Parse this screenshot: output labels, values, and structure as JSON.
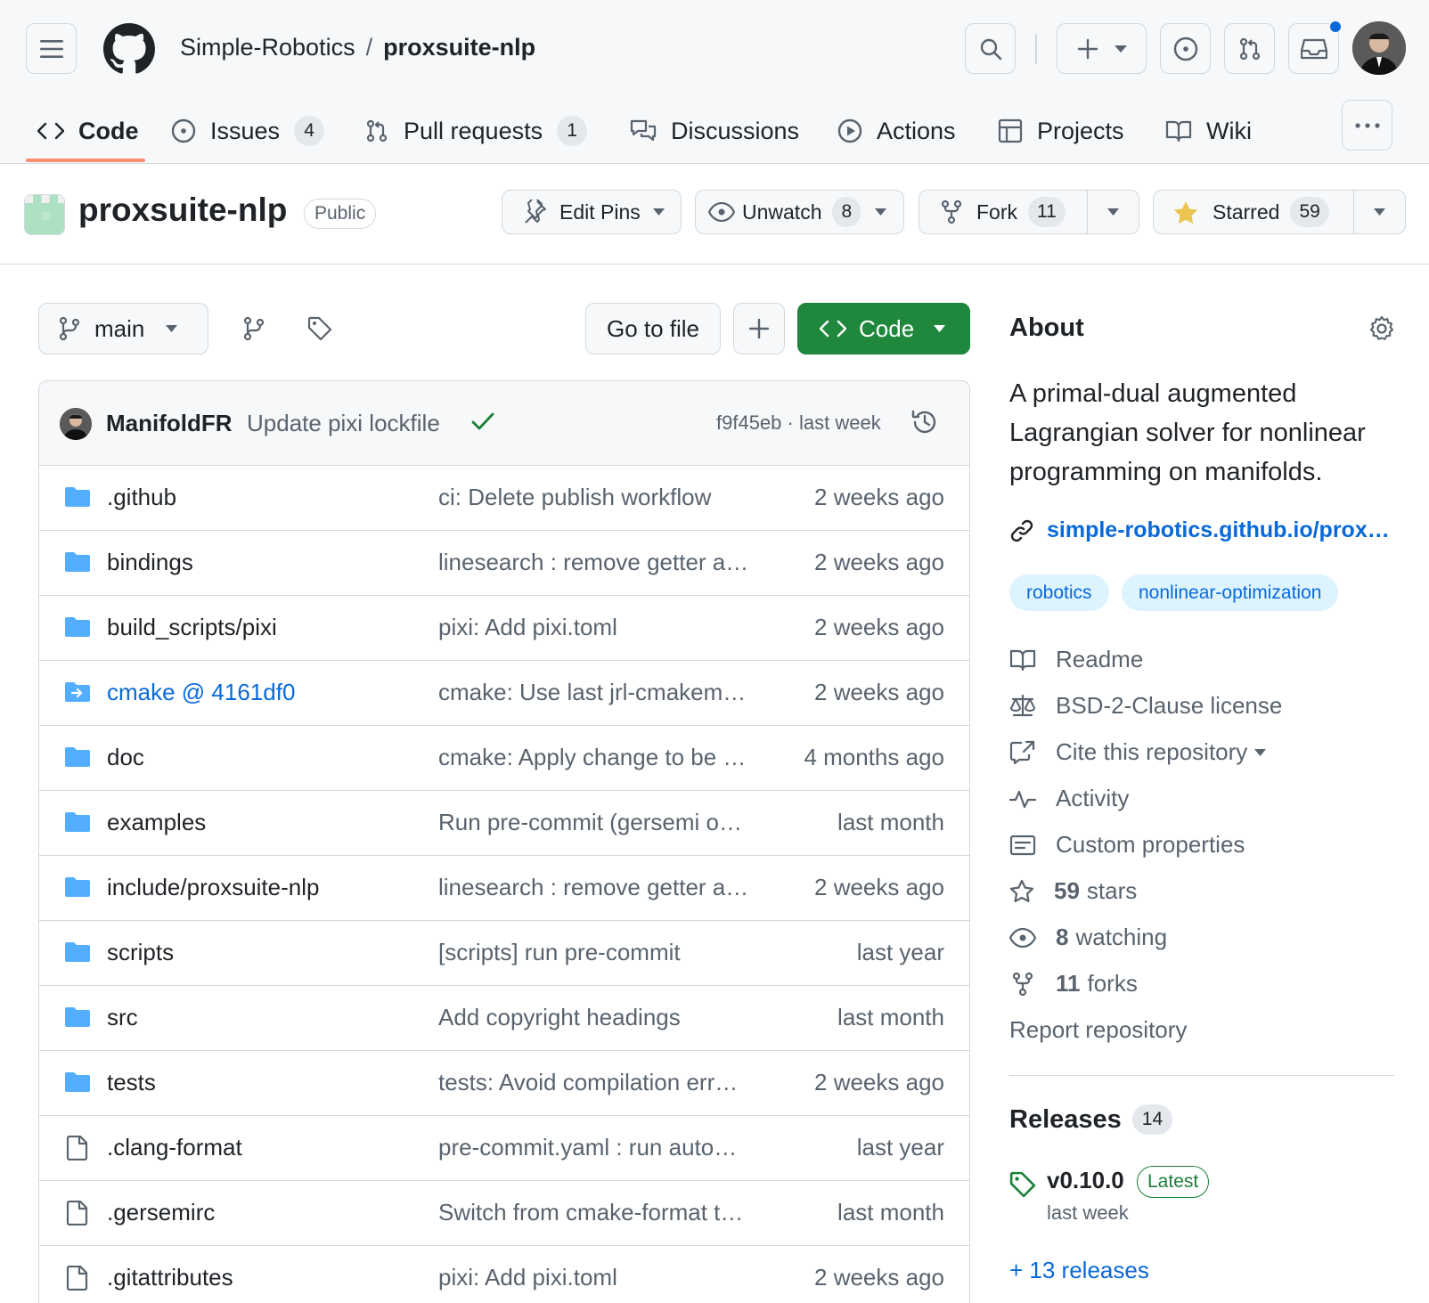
{
  "breadcrumb": {
    "owner": "Simple-Robotics",
    "separator": "/",
    "repo": "proxsuite-nlp"
  },
  "nav_tabs": [
    {
      "label": "Code",
      "icon": "code-icon",
      "active": true
    },
    {
      "label": "Issues",
      "count": "4",
      "icon": "issue-opened-icon"
    },
    {
      "label": "Pull requests",
      "count": "1",
      "icon": "git-pull-request-icon"
    },
    {
      "label": "Discussions",
      "icon": "comment-discussion-icon"
    },
    {
      "label": "Actions",
      "icon": "play-icon"
    },
    {
      "label": "Projects",
      "icon": "table-icon"
    },
    {
      "label": "Wiki",
      "icon": "book-icon"
    }
  ],
  "repo_header": {
    "name": "proxsuite-nlp",
    "visibility": "Public",
    "edit_pins": "Edit Pins",
    "unwatch": "Unwatch",
    "watch_count": "8",
    "fork": "Fork",
    "fork_count": "11",
    "starred": "Starred",
    "star_count": "59"
  },
  "toolbar": {
    "branch": "main",
    "go_to_file": "Go to file",
    "add": "+",
    "code": "Code"
  },
  "latest_commit": {
    "author": "ManifoldFR",
    "message": "Update pixi lockfile",
    "hash": "f9f45eb",
    "separator": "·",
    "time": "last week"
  },
  "files": [
    {
      "type": "dir",
      "name": ".github",
      "message": "ci: Delete publish workflow",
      "date": "2 weeks ago"
    },
    {
      "type": "dir",
      "name": "bindings",
      "message": "linesearch : remove getter a…",
      "date": "2 weeks ago"
    },
    {
      "type": "dir",
      "name": "build_scripts/pixi",
      "message": "pixi: Add pixi.toml",
      "date": "2 weeks ago"
    },
    {
      "type": "submodule",
      "name": "cmake @ 4161df0",
      "message": "cmake: Use last jrl-cmakem…",
      "date": "2 weeks ago"
    },
    {
      "type": "dir",
      "name": "doc",
      "message": "cmake: Apply change to be …",
      "date": "4 months ago"
    },
    {
      "type": "dir",
      "name": "examples",
      "message": "Run pre-commit (gersemi o…",
      "date": "last month"
    },
    {
      "type": "dir",
      "name": "include/proxsuite-nlp",
      "message": "linesearch : remove getter a…",
      "date": "2 weeks ago"
    },
    {
      "type": "dir",
      "name": "scripts",
      "message": "[scripts] run pre-commit",
      "date": "last year"
    },
    {
      "type": "dir",
      "name": "src",
      "message": "Add copyright headings",
      "date": "last month"
    },
    {
      "type": "dir",
      "name": "tests",
      "message": "tests: Avoid compilation err…",
      "date": "2 weeks ago"
    },
    {
      "type": "file",
      "name": ".clang-format",
      "message": "pre-commit.yaml : run auto…",
      "date": "last year"
    },
    {
      "type": "file",
      "name": ".gersemirc",
      "message": "Switch from cmake-format t…",
      "date": "last month"
    },
    {
      "type": "file",
      "name": ".gitattributes",
      "message": "pixi: Add pixi.toml",
      "date": "2 weeks ago"
    }
  ],
  "about": {
    "title": "About",
    "description": "A primal-dual augmented Lagrangian solver for nonlinear programming on manifolds.",
    "homepage": "simple-robotics.github.io/proxsuite-nlp",
    "topics": [
      "robotics",
      "nonlinear-optimization"
    ],
    "readme": "Readme",
    "license": "BSD-2-Clause license",
    "cite": "Cite this repository",
    "activity": "Activity",
    "custom_properties": "Custom properties",
    "stars_count": "59",
    "stars_label": "stars",
    "watching_count": "8",
    "watching_label": "watching",
    "forks_count": "11",
    "forks_label": "forks",
    "report": "Report repository"
  },
  "releases": {
    "title": "Releases",
    "count": "14",
    "latest_version": "v0.10.0",
    "latest_badge": "Latest",
    "latest_date": "last week",
    "more": "+ 13 releases"
  },
  "colors": {
    "accent": "#0969da",
    "green": "#1f883d",
    "tab_underline": "#fd8c73",
    "folder": "#54aeff",
    "star": "#eac54f"
  }
}
